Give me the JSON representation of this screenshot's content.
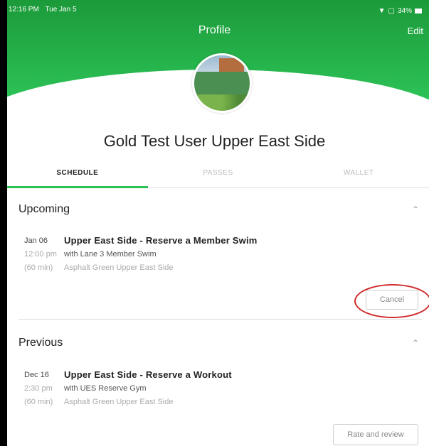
{
  "status_bar": {
    "time": "12:16 PM",
    "date": "Tue Jan 5",
    "battery": "34%"
  },
  "header": {
    "title": "Profile",
    "edit_label": "Edit"
  },
  "profile": {
    "name": "Gold Test User Upper East Side"
  },
  "tabs": [
    {
      "label": "SCHEDULE",
      "active": true
    },
    {
      "label": "PASSES",
      "active": false
    },
    {
      "label": "WALLET",
      "active": false
    }
  ],
  "upcoming": {
    "heading": "Upcoming",
    "entry": {
      "date": "Jan 06",
      "time": "12:00 pm",
      "duration": "(60 min)",
      "title": "Upper East Side - Reserve a Member Swim",
      "with": "with Lane 3 Member Swim",
      "location": "Asphalt Green Upper East Side"
    },
    "cancel_label": "Cancel"
  },
  "previous": {
    "heading": "Previous",
    "entry": {
      "date": "Dec 16",
      "time": "2:30 pm",
      "duration": "(60 min)",
      "title": "Upper East Side - Reserve a Workout",
      "with": "with UES Reserve Gym",
      "location": "Asphalt Green Upper East Side"
    },
    "rate_label": "Rate and review"
  },
  "colors": {
    "accent": "#2cc256",
    "annotation": "#d12a2a"
  }
}
